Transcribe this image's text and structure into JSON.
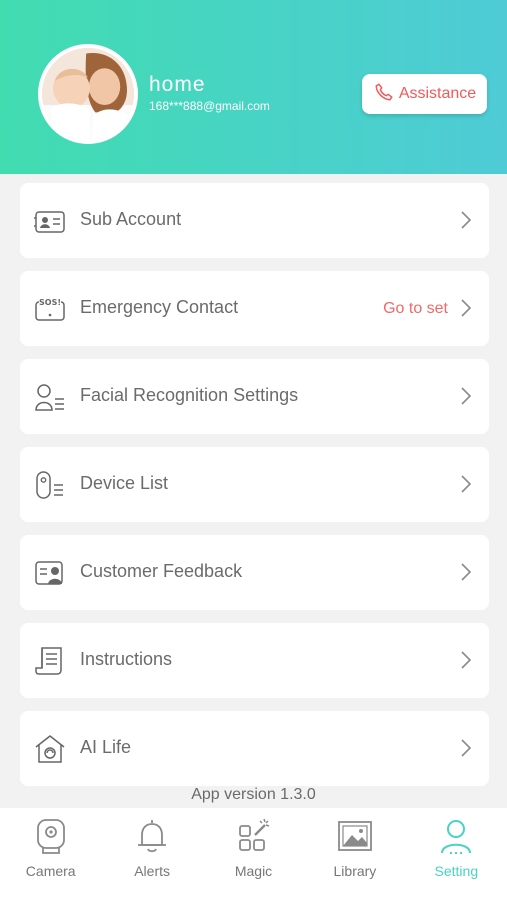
{
  "profile": {
    "name": "home",
    "email": "168***888@gmail.com",
    "avatar": "mother-and-baby-photo"
  },
  "assistance_button": {
    "label": "Assistance",
    "icon": "phone-icon",
    "color": "#f05a5a"
  },
  "menu": [
    {
      "label": "Sub Account",
      "icon": "id-card-icon",
      "status": ""
    },
    {
      "label": "Emergency Contact",
      "icon": "sos-icon",
      "status": "Go to set"
    },
    {
      "label": "Facial Recognition Settings",
      "icon": "person-list-icon",
      "status": ""
    },
    {
      "label": "Device List",
      "icon": "camera-device-list-icon",
      "status": ""
    },
    {
      "label": "Customer Feedback",
      "icon": "feedback-icon",
      "status": ""
    },
    {
      "label": "Instructions",
      "icon": "document-icon",
      "status": ""
    },
    {
      "label": "AI Life",
      "icon": "smart-home-icon",
      "status": ""
    }
  ],
  "version": "App version 1.3.0",
  "tabs": [
    {
      "label": "Camera",
      "icon": "camera-icon",
      "active": false
    },
    {
      "label": "Alerts",
      "icon": "bell-icon",
      "active": false
    },
    {
      "label": "Magic",
      "icon": "magic-grid-icon",
      "active": false
    },
    {
      "label": "Library",
      "icon": "image-icon",
      "active": false
    },
    {
      "label": "Setting",
      "icon": "user-icon",
      "active": true
    }
  ],
  "colors": {
    "accent": "#48d3c2",
    "header_start": "#41dcb0",
    "header_end": "#4fcbd6",
    "alert": "#ef6a6a"
  }
}
